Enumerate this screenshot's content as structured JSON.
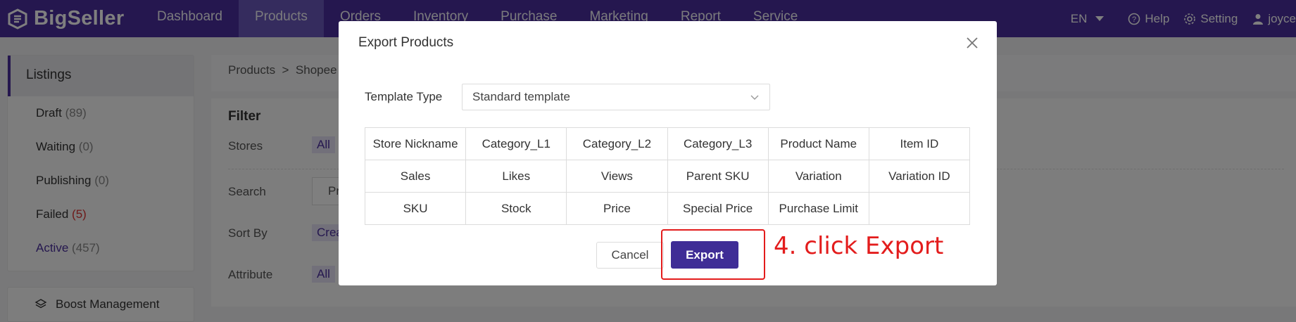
{
  "app": {
    "brand": "BigSeller",
    "nav": [
      "Dashboard",
      "Products",
      "Orders",
      "Inventory",
      "Purchase",
      "Marketing",
      "Report",
      "Service"
    ],
    "active_nav": "Products",
    "language": "EN",
    "help": "Help",
    "setting": "Setting",
    "user": "joyce"
  },
  "sidebar": {
    "header": "Listings",
    "items": [
      {
        "label": "Draft",
        "count": "(89)"
      },
      {
        "label": "Waiting",
        "count": "(0)"
      },
      {
        "label": "Publishing",
        "count": "(0)"
      },
      {
        "label": "Failed",
        "count": "(5)"
      },
      {
        "label": "Active",
        "count": "(457)"
      }
    ],
    "boost": "Boost Management"
  },
  "page": {
    "breadcrumb": "Products  >  Shopee",
    "filter_title": "Filter",
    "labels": {
      "stores": "Stores",
      "search": "Search",
      "sort_by": "Sort By",
      "attribute": "Attribute"
    },
    "stores_value": "All",
    "search_value": "Pr",
    "sort_value": "Crea",
    "attribute_value": "All"
  },
  "modal": {
    "title": "Export Products",
    "template_type_label": "Template Type",
    "template_type_value": "Standard template",
    "fields": [
      [
        "Store Nickname",
        "Category_L1",
        "Category_L2",
        "Category_L3",
        "Product Name",
        "Item ID"
      ],
      [
        "Sales",
        "Likes",
        "Views",
        "Parent SKU",
        "Variation",
        "Variation ID"
      ],
      [
        "SKU",
        "Stock",
        "Price",
        "Special Price",
        "Purchase Limit",
        ""
      ]
    ],
    "cancel_label": "Cancel",
    "export_label": "Export"
  },
  "annotation": {
    "text": "4. click Export",
    "color": "#e31c1c"
  },
  "colors": {
    "brand": "#4a2f9e",
    "primary_button": "#3f2d96"
  }
}
